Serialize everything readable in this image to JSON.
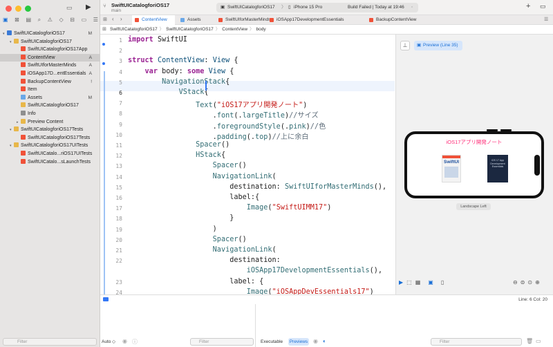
{
  "app": {
    "project_name": "SwiftUICatalogforiOS17",
    "branch": "main",
    "scheme": "SwiftUICatalogforiOS17",
    "device": "iPhone 15 Pro",
    "build_status": "Build Failed | Today at 19:46"
  },
  "colors": {
    "accent": "#1a6fd6",
    "swift_orange": "#f05138",
    "folder_yellow": "#e8b74a",
    "pink": "#ff2d78"
  },
  "sidebar": {
    "items": [
      {
        "label": "SwiftUICatalogforiOS17",
        "badge": "M",
        "level": 0,
        "kind": "project",
        "disc": "▾"
      },
      {
        "label": "SwiftUICatalogforiOS17",
        "badge": "",
        "level": 1,
        "kind": "folder",
        "disc": "▾"
      },
      {
        "label": "SwiftUICatalogforiOS17App",
        "badge": "",
        "level": 2,
        "kind": "swift",
        "disc": ""
      },
      {
        "label": "ContentView",
        "badge": "A",
        "level": 2,
        "kind": "swift",
        "disc": "",
        "selected": true
      },
      {
        "label": "SwiftUIforMasterMinds",
        "badge": "A",
        "level": 2,
        "kind": "swift",
        "disc": ""
      },
      {
        "label": "iOSApp17D...entEssentials",
        "badge": "A",
        "level": 2,
        "kind": "swift",
        "disc": ""
      },
      {
        "label": "BackupContentView",
        "badge": "!",
        "level": 2,
        "kind": "swift",
        "disc": ""
      },
      {
        "label": "Item",
        "badge": "",
        "level": 2,
        "kind": "swift",
        "disc": ""
      },
      {
        "label": "Assets",
        "badge": "M",
        "level": 2,
        "kind": "assets",
        "disc": ""
      },
      {
        "label": "SwiftUICatalogforiOS17",
        "badge": "",
        "level": 2,
        "kind": "ent",
        "disc": ""
      },
      {
        "label": "Info",
        "badge": "",
        "level": 2,
        "kind": "plist",
        "disc": ""
      },
      {
        "label": "Preview Content",
        "badge": "",
        "level": 2,
        "kind": "folder",
        "disc": "▸"
      },
      {
        "label": "SwiftUICatalogforiOS17Tests",
        "badge": "",
        "level": 1,
        "kind": "folder",
        "disc": "▾"
      },
      {
        "label": "SwiftUICatalogforiOS17Tests",
        "badge": "",
        "level": 2,
        "kind": "swift",
        "disc": ""
      },
      {
        "label": "SwiftUICatalogforiOS17UITests",
        "badge": "",
        "level": 1,
        "kind": "folder",
        "disc": "▾"
      },
      {
        "label": "SwiftUICatalo...riOS17UITests",
        "badge": "",
        "level": 2,
        "kind": "swift",
        "disc": ""
      },
      {
        "label": "SwiftUICatalo...sLaunchTests",
        "badge": "",
        "level": 2,
        "kind": "swift",
        "disc": ""
      }
    ],
    "filter_placeholder": "Filter"
  },
  "tabs": [
    {
      "label": "ContentView",
      "active": true
    },
    {
      "label": "Assets",
      "active": false
    },
    {
      "label": "SwiftUIforMasterMinds",
      "active": false
    },
    {
      "label": "iOSApp17DevelopmentEssentials",
      "active": false
    },
    {
      "label": "BackupContentView",
      "active": false
    }
  ],
  "jumpbar": [
    "SwiftUICatalogforiOS17",
    "SwiftUICatalogforiOS17",
    "ContentView",
    "body"
  ],
  "code_lines": [
    {
      "n": "1",
      "html": "<span class=\"kw\">import</span> SwiftUI"
    },
    {
      "n": "2",
      "html": ""
    },
    {
      "n": "3",
      "html": "<span class=\"kw\">struct</span> <span class=\"ty\">ContentView</span>: <span class=\"ty\">View</span> {"
    },
    {
      "n": "4",
      "html": "    <span class=\"kw\">var</span> body: <span class=\"kw\">some</span> <span class=\"ty\">View</span> {"
    },
    {
      "n": "5",
      "html": "        <span class=\"fn\">NavigationStack</span>{"
    },
    {
      "n": "6",
      "html": "            <span class=\"fn\">VStack</span>{"
    },
    {
      "n": "7",
      "html": "                <span class=\"fn\">Text</span>(<span class=\"st\">\"iOS17アプリ開発ノート\"</span>)"
    },
    {
      "n": "8",
      "html": "                    .<span class=\"fn\">font</span>(.<span class=\"fn\">largeTitle</span>)<span class=\"cm\">//サイズ</span>"
    },
    {
      "n": "9",
      "html": "                    .<span class=\"fn\">foregroundStyle</span>(.<span class=\"fn\">pink</span>)<span class=\"cm\">//色</span>"
    },
    {
      "n": "10",
      "html": "                    .<span class=\"fn\">padding</span>(.<span class=\"fn\">top</span>)<span class=\"cm\">//上に余白</span>"
    },
    {
      "n": "11",
      "html": "                <span class=\"fn\">Spacer</span>()"
    },
    {
      "n": "12",
      "html": "                <span class=\"fn\">HStack</span>{"
    },
    {
      "n": "13",
      "html": "                    <span class=\"fn\">Spacer</span>()"
    },
    {
      "n": "14",
      "html": "                    <span class=\"fn\">NavigationLink</span>("
    },
    {
      "n": "15",
      "html": "                        destination: <span class=\"fn\">SwiftUIforMasterMinds</span>(),"
    },
    {
      "n": "16",
      "html": "                        label:{"
    },
    {
      "n": "17",
      "html": "                            <span class=\"fn\">Image</span>(<span class=\"st\">\"SwiftUIMM17\"</span>)"
    },
    {
      "n": "18",
      "html": "                        }"
    },
    {
      "n": "19",
      "html": "                    )"
    },
    {
      "n": "20",
      "html": "                    <span class=\"fn\">Spacer</span>()"
    },
    {
      "n": "21",
      "html": "                    <span class=\"fn\">NavigationLink</span>("
    },
    {
      "n": "22",
      "html": "                        destination:"
    },
    {
      "n": "",
      "html": "                            <span class=\"fn\">iOSApp17DevelopmentEssentials</span>(),"
    },
    {
      "n": "23",
      "html": "                        label: {"
    },
    {
      "n": "24",
      "html": "                            <span class=\"fn\">Image</span>(<span class=\"st\">\"iOSAppDevEssentials17\"</span>)"
    },
    {
      "n": "25",
      "html": "                        }"
    },
    {
      "n": "26",
      "html": "                    )"
    }
  ],
  "canvas": {
    "preview_label": "Preview (Line 35)",
    "preview_title": "iOS17アプリ開発ノート",
    "orientation_label": "Landscape Left",
    "book1": "SwiftUI",
    "book2": "iOS 17 App Development Essentials"
  },
  "status": {
    "position": "Line: 6  Col: 20"
  },
  "debug": {
    "auto_label": "Auto ◇",
    "filter_placeholder": "Filter",
    "executable_tab": "Executable",
    "previews_tab": "Previews"
  }
}
